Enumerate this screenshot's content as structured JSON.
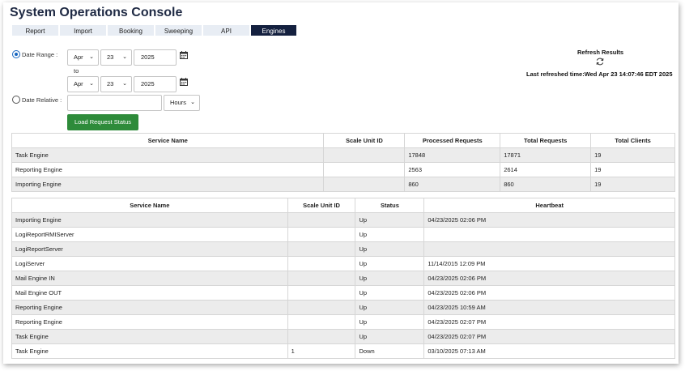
{
  "app": {
    "title": "System Operations Console"
  },
  "tabs": [
    {
      "label": "Report",
      "active": false
    },
    {
      "label": "Import",
      "active": false
    },
    {
      "label": "Booking",
      "active": false
    },
    {
      "label": "Sweeping",
      "active": false
    },
    {
      "label": "API",
      "active": false
    },
    {
      "label": "Engines",
      "active": true
    }
  ],
  "filters": {
    "date_range_label": "Date Range :",
    "date_range_selected": true,
    "from": {
      "month": "Apr",
      "day": "23",
      "year": "2025"
    },
    "to_label": "to",
    "to": {
      "month": "Apr",
      "day": "23",
      "year": "2025"
    },
    "date_relative_label": "Date Relative :",
    "date_relative_selected": false,
    "relative_value": "",
    "relative_unit": "Hours",
    "load_button": "Load Request Status"
  },
  "refresh": {
    "title": "Refresh Results",
    "last_refreshed": "Last refreshed time:Wed Apr 23 14:07:46 EDT 2025"
  },
  "requests_table": {
    "headers": [
      "Service Name",
      "Scale Unit ID",
      "Processed Requests",
      "Total Requests",
      "Total Clients"
    ],
    "rows": [
      [
        "Task Engine",
        "",
        "17848",
        "17871",
        "19"
      ],
      [
        "Reporting Engine",
        "",
        "2563",
        "2614",
        "19"
      ],
      [
        "Importing Engine",
        "",
        "860",
        "860",
        "19"
      ]
    ]
  },
  "status_table": {
    "headers": [
      "Service Name",
      "Scale Unit ID",
      "Status",
      "Heartbeat"
    ],
    "rows": [
      [
        "Importing Engine",
        "",
        "Up",
        "04/23/2025 02:06 PM"
      ],
      [
        "LogiReportRMIServer",
        "",
        "Up",
        ""
      ],
      [
        "LogiReportServer",
        "",
        "Up",
        ""
      ],
      [
        "LogiServer",
        "",
        "Up",
        "11/14/2015 12:09 PM"
      ],
      [
        "Mail Engine IN",
        "",
        "Up",
        "04/23/2025 02:06 PM"
      ],
      [
        "Mail Engine OUT",
        "",
        "Up",
        "04/23/2025 02:06 PM"
      ],
      [
        "Reporting Engine",
        "",
        "Up",
        "04/23/2025 10:59 AM"
      ],
      [
        "Reporting Engine",
        "",
        "Up",
        "04/23/2025 02:07 PM"
      ],
      [
        "Task Engine",
        "",
        "Up",
        "04/23/2025 02:07 PM"
      ],
      [
        "Task Engine",
        "1",
        "Down",
        "03/10/2025 07:13 AM"
      ]
    ]
  }
}
